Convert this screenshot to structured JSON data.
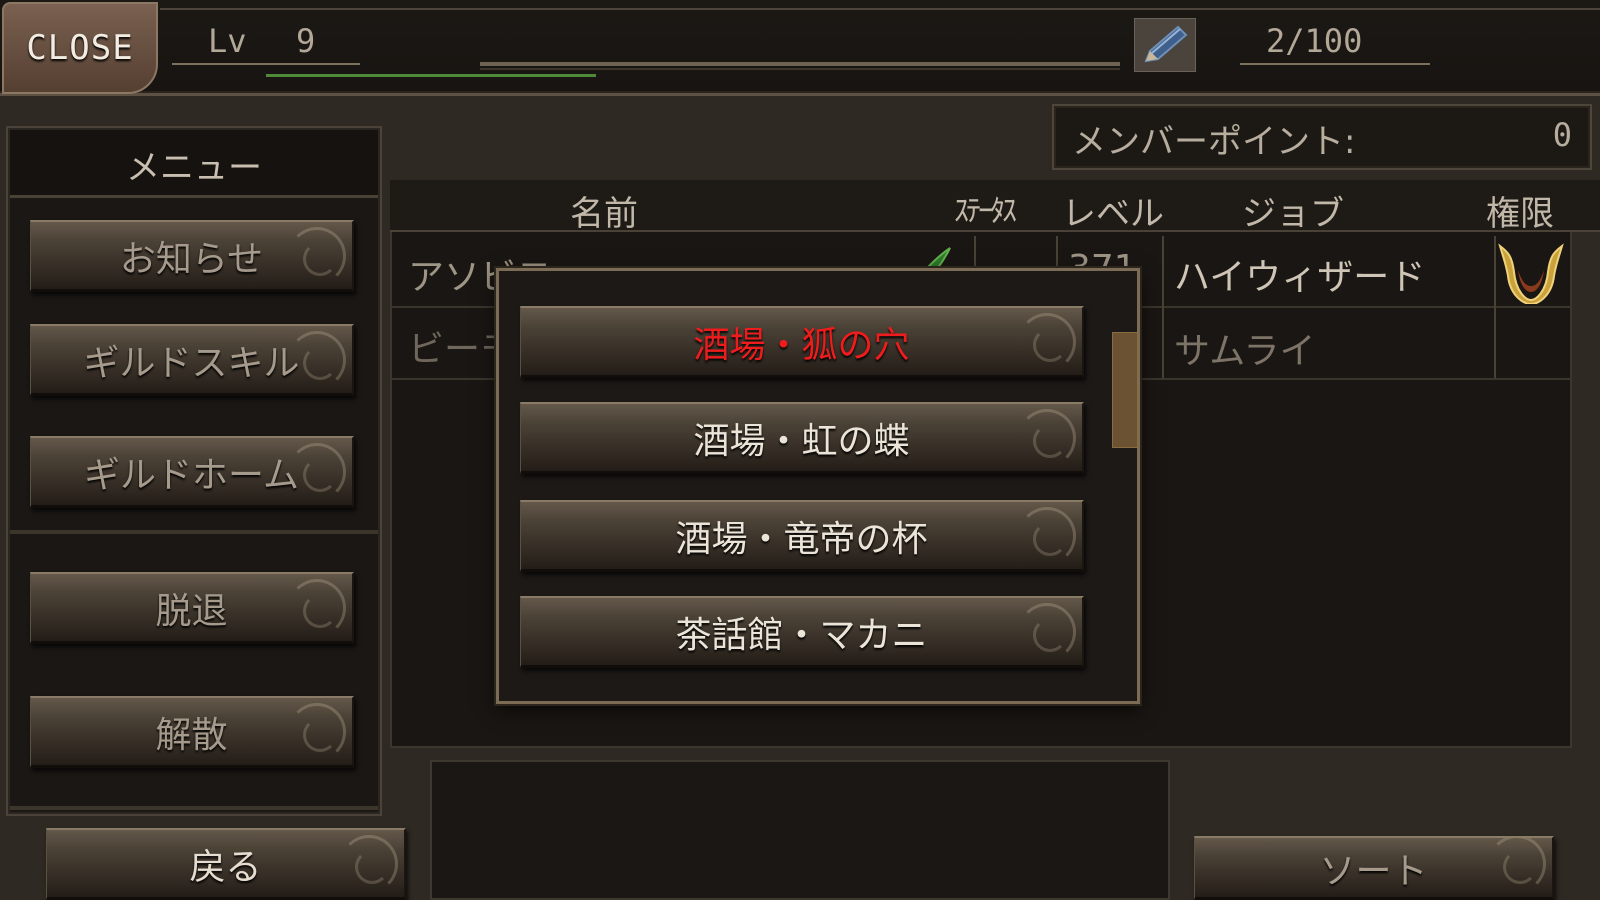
{
  "top_bar": {
    "close_label": "CLOSE",
    "level_label": "Lv",
    "level_value": "9",
    "member_count": "2/100",
    "edit_icon": "pencil-icon"
  },
  "menu": {
    "title": "メニュー",
    "items": [
      {
        "label": "お知らせ"
      },
      {
        "label": "ギルドスキル"
      },
      {
        "label": "ギルドホーム"
      },
      {
        "label": "脱退"
      },
      {
        "label": "解散"
      }
    ],
    "back_label": "戻る"
  },
  "member_points": {
    "label": "メンバーポイント:",
    "value": "0"
  },
  "table": {
    "headers": {
      "name": "名前",
      "status": "ｽﾃｰﾀｽ",
      "level": "レベル",
      "job": "ジョブ",
      "rank": "権限"
    },
    "rows": [
      {
        "name": "アソビモ",
        "level": "371",
        "job": "ハイウィザード",
        "rank_icon": "guild-master-emblem-icon"
      },
      {
        "name": "ビーモ",
        "level": "",
        "job": "サムライ",
        "rank_icon": ""
      }
    ]
  },
  "popup": {
    "options": [
      {
        "label": "酒場・狐の穴",
        "selected": true
      },
      {
        "label": "酒場・虹の蝶",
        "selected": false
      },
      {
        "label": "酒場・竜帝の杯",
        "selected": false
      },
      {
        "label": "茶話館・マカニ",
        "selected": false
      }
    ]
  },
  "sort_label": "ソート",
  "colors": {
    "selected_text": "#ee1c1c",
    "panel_border": "#7c6c56",
    "exp_fill": "#4f8a3a"
  }
}
